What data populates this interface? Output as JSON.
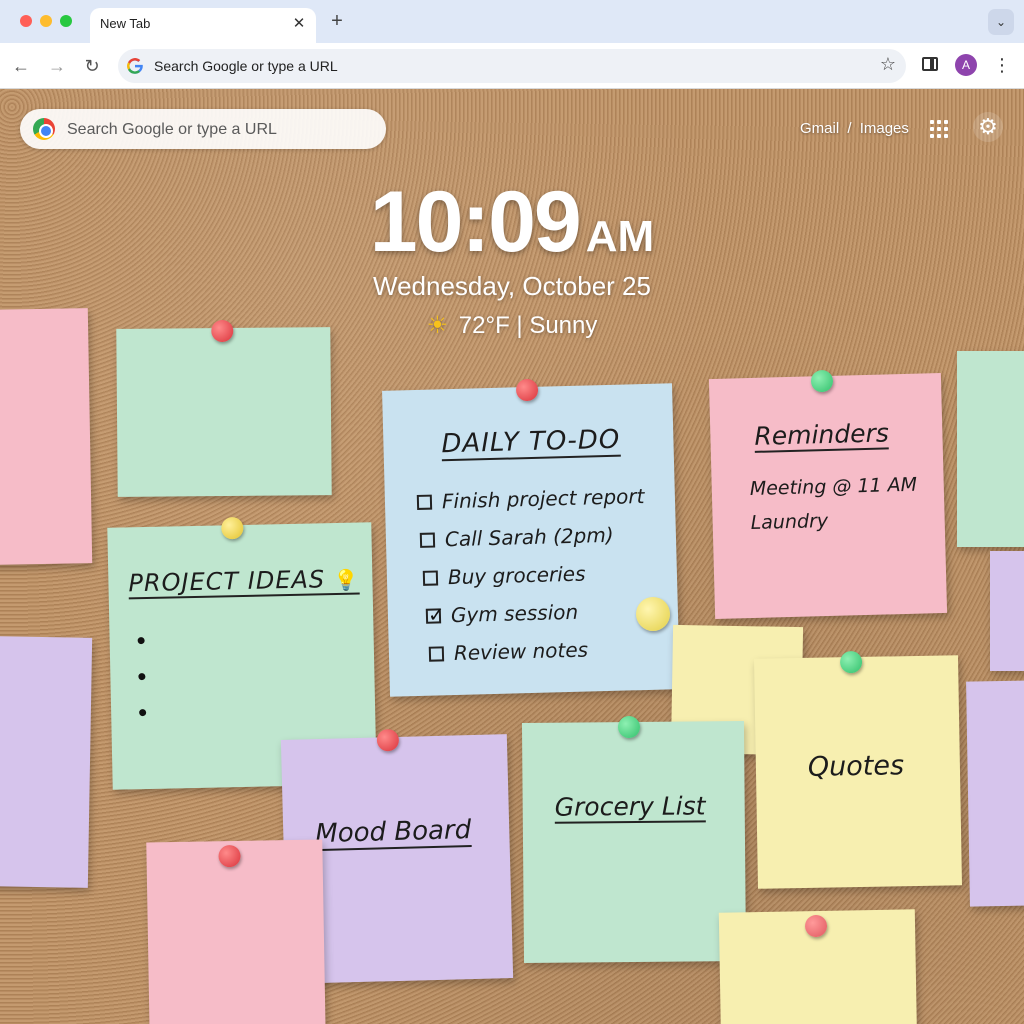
{
  "tab": {
    "title": "New Tab",
    "close": "✕",
    "new_tab": "+",
    "tab_search": "⌄"
  },
  "toolbar": {
    "back": "←",
    "forward": "→",
    "reload": "↻",
    "omnibox_text": "Search Google or type a URL",
    "star": "☆",
    "avatar": "A",
    "menu": "⋮"
  },
  "page": {
    "search_placeholder": "Search Google or type a URL",
    "links": {
      "gmail": "Gmail",
      "separator": "/",
      "images": "Images"
    },
    "settings": "⚙",
    "clock": {
      "time": "10:09",
      "ampm": "AM"
    },
    "date": "Wednesday, October 25",
    "weather": {
      "icon": "☀",
      "text": "72°F | Sunny"
    }
  },
  "notes": {
    "project_ideas": {
      "title": "PROJECT IDEAS",
      "bulb": "💡"
    },
    "todo": {
      "title": "DAILY TO-DO",
      "items": [
        {
          "label": "Finish project report",
          "checked": false
        },
        {
          "label": "Call Sarah (2pm)",
          "checked": false
        },
        {
          "label": "Buy groceries",
          "checked": false
        },
        {
          "label": "Gym session",
          "checked": true
        },
        {
          "label": "Review notes",
          "checked": false
        }
      ]
    },
    "reminders": {
      "title": "Reminders",
      "lines": [
        "Meeting @ 11 AM",
        "Laundry"
      ]
    },
    "mood_board": {
      "title": "Mood Board"
    },
    "grocery": {
      "title": "Grocery List"
    },
    "quotes": {
      "title": "Quotes"
    }
  },
  "colors": {
    "green_note": "#bfe6cf",
    "blue_note": "#c9e2f0",
    "pink_note": "#f6bcc8",
    "yellow_note": "#f7efb0",
    "purple_note": "#d6c4ec",
    "cork": "#bf9468"
  }
}
